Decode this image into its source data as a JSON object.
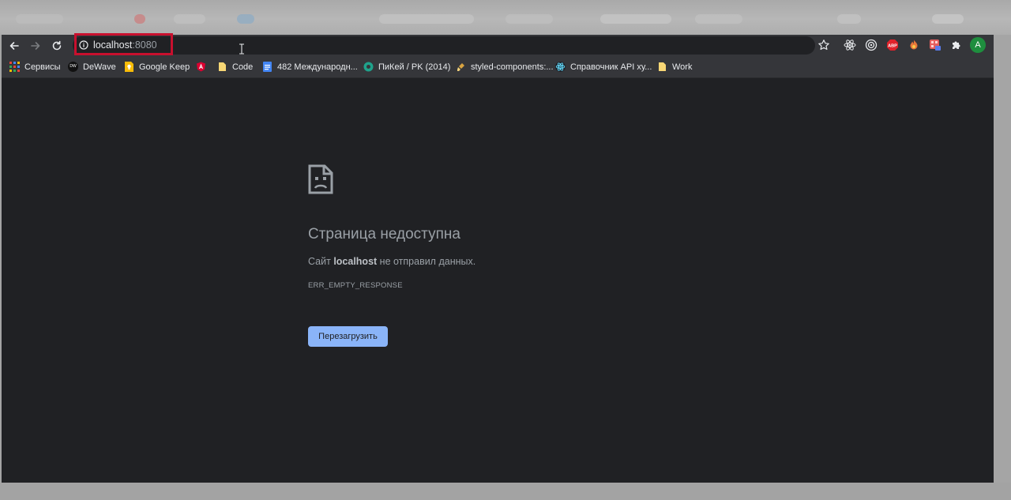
{
  "browser": {
    "url_host": "localhost",
    "url_port": ":8080",
    "profile_initial": "A",
    "abp_label": "ABP"
  },
  "bookmarks": [
    {
      "label": "Сервисы",
      "icon": "apps-grid-icon"
    },
    {
      "label": "DeWave",
      "icon": "dewave-logo-icon"
    },
    {
      "label": "Google Keep",
      "icon": "google-keep-icon"
    },
    {
      "label": "",
      "icon": "angular-icon"
    },
    {
      "label": "Code",
      "icon": "folder-icon"
    },
    {
      "label": "482 Международн...",
      "icon": "google-docs-icon"
    },
    {
      "label": "ПиКей / PK (2014)",
      "icon": "site-icon"
    },
    {
      "label": "styled-components:...",
      "icon": "nail-polish-icon"
    },
    {
      "label": "Справочник API ху...",
      "icon": "react-icon"
    },
    {
      "label": "Work",
      "icon": "folder-icon"
    }
  ],
  "error": {
    "title": "Страница недоступна",
    "message_prefix": "Сайт ",
    "message_host": "localhost",
    "message_suffix": " не отправил данных.",
    "code": "ERR_EMPTY_RESPONSE",
    "reload_label": "Перезагрузить"
  },
  "colors": {
    "accent": "#8ab4f8",
    "highlight": "#c8102e",
    "page_bg": "#202124"
  }
}
